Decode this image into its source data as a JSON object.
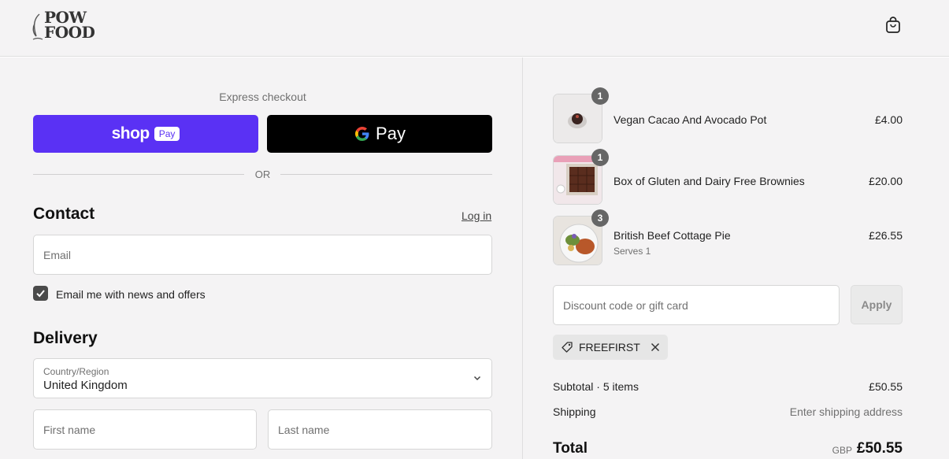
{
  "brand": {
    "logo_line1": "POW",
    "logo_line2": "FOOD"
  },
  "header": {
    "cart_icon": "shopping-bag-icon"
  },
  "express": {
    "label": "Express checkout",
    "shop_pay_word": "shop",
    "shop_pay_badge": "Pay",
    "gpay_word": "Pay",
    "or_text": "OR"
  },
  "contact": {
    "heading": "Contact",
    "login_link": "Log in",
    "email_placeholder": "Email",
    "newsletter_label": "Email me with news and offers",
    "newsletter_checked": true
  },
  "delivery": {
    "heading": "Delivery",
    "country_label": "Country/Region",
    "country_value": "United Kingdom",
    "first_name_placeholder": "First name",
    "last_name_placeholder": "Last name"
  },
  "order": {
    "items": [
      {
        "name": "Vegan Cacao And Avocado Pot",
        "qty": "1",
        "price": "£4.00",
        "subtitle": ""
      },
      {
        "name": "Box of Gluten and Dairy Free Brownies",
        "qty": "1",
        "price": "£20.00",
        "subtitle": ""
      },
      {
        "name": "British Beef Cottage Pie",
        "qty": "3",
        "price": "£26.55",
        "subtitle": "Serves 1"
      }
    ],
    "discount_placeholder": "Discount code or gift card",
    "apply_label": "Apply",
    "applied_code": "FREEFIRST",
    "subtotal_label": "Subtotal · 5 items",
    "subtotal_value": "£50.55",
    "shipping_label": "Shipping",
    "shipping_value": "Enter shipping address",
    "total_label": "Total",
    "total_currency": "GBP",
    "total_value": "£50.55"
  },
  "colors": {
    "shop_pay": "#5a31f4",
    "gpay": "#000000",
    "page_bg": "#f4f3f4"
  }
}
